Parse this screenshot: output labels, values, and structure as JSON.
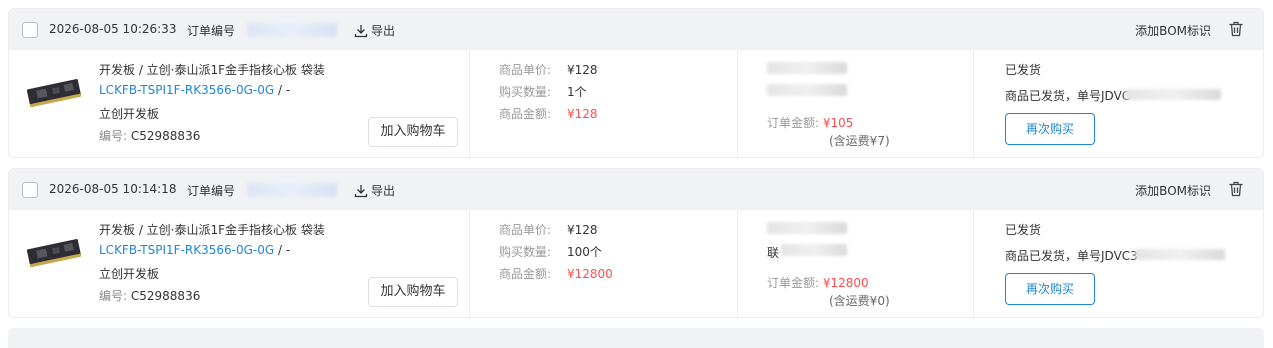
{
  "orders": [
    {
      "date": "2026-08-05 10:26:33",
      "order_no_label": "订单编号",
      "export_label": "导出",
      "bom_label": "添加BOM标识",
      "product_name": "开发板 / 立创·泰山派1F金手指核心板 袋装",
      "product_code": "LCKFB-TSPI1F-RK3566-0G-0G",
      "code_suffix": " / -",
      "brand": "立创开发板",
      "part_no_label": "编号:",
      "part_no": "C52988836",
      "cart_label": "加入购物车",
      "unit_price_label": "商品单价:",
      "unit_price": "¥128",
      "qty_label": "购买数量:",
      "qty": "1个",
      "amount_label": "商品金额:",
      "amount": "¥128",
      "receiver_tail": "",
      "total_label": "订单金额:",
      "total": "¥105",
      "shipping": "(含运费¥7)",
      "status": "已发货",
      "ship_info": "商品已发货，单号JDVC",
      "rebuy_label": "再次购买"
    },
    {
      "date": "2026-08-05 10:14:18",
      "order_no_label": "订单编号",
      "export_label": "导出",
      "bom_label": "添加BOM标识",
      "product_name": "开发板 / 立创·泰山派1F金手指核心板 袋装",
      "product_code": "LCKFB-TSPI1F-RK3566-0G-0G",
      "code_suffix": " / -",
      "brand": "立创开发板",
      "part_no_label": "编号:",
      "part_no": "C52988836",
      "cart_label": "加入购物车",
      "unit_price_label": "商品单价:",
      "unit_price": "¥128",
      "qty_label": "购买数量:",
      "qty": "100个",
      "amount_label": "商品金额:",
      "amount": "¥12800",
      "receiver_tail": "联",
      "total_label": "订单金额:",
      "total": "¥12800",
      "shipping": "(含运费¥0)",
      "status": "已发货",
      "ship_info": "商品已发货，单号JDVC3",
      "rebuy_label": "再次购买"
    }
  ]
}
